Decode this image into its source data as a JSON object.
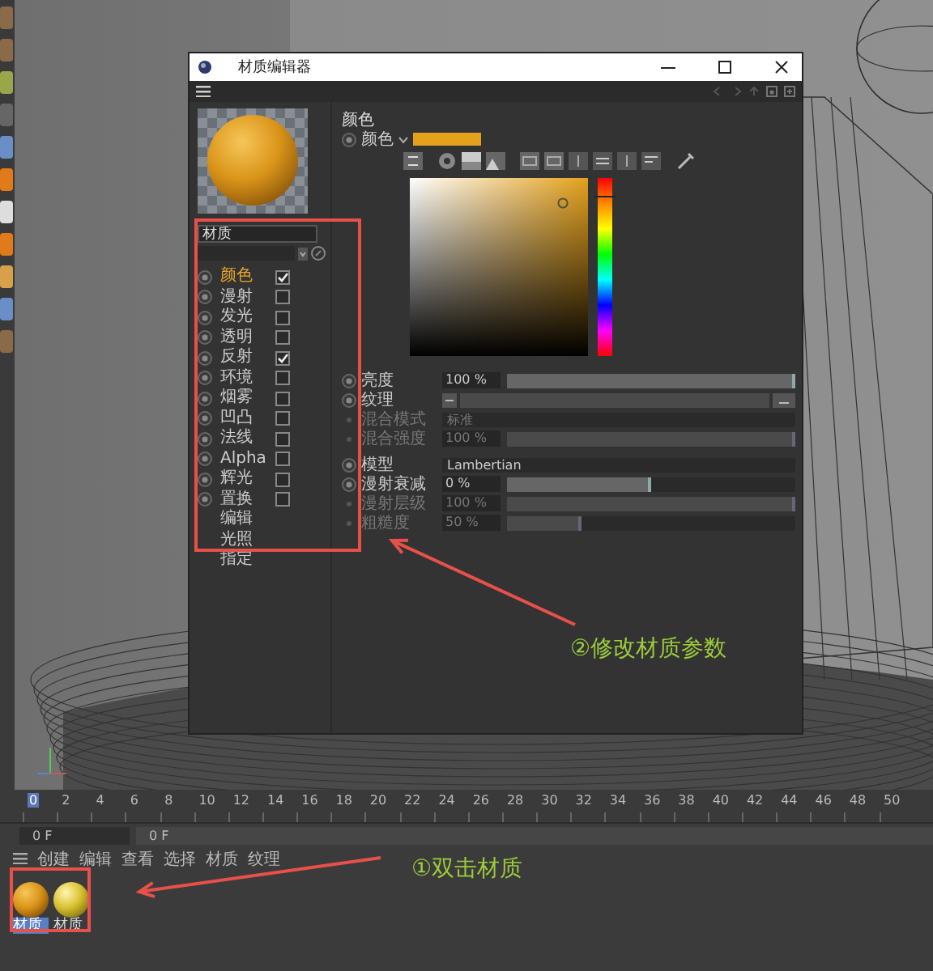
{
  "window": {
    "title": "材质编辑器"
  },
  "name_field": {
    "value": "材质"
  },
  "channels": [
    {
      "label": "颜色",
      "kind": "channel",
      "checked": true,
      "selected": true
    },
    {
      "label": "漫射",
      "kind": "channel",
      "checked": false,
      "selected": false
    },
    {
      "label": "发光",
      "kind": "channel",
      "checked": false,
      "selected": false
    },
    {
      "label": "透明",
      "kind": "channel",
      "checked": false,
      "selected": false
    },
    {
      "label": "反射",
      "kind": "channel",
      "checked": true,
      "selected": false
    },
    {
      "label": "环境",
      "kind": "channel",
      "checked": false,
      "selected": false
    },
    {
      "label": "烟雾",
      "kind": "channel",
      "checked": false,
      "selected": false
    },
    {
      "label": "凹凸",
      "kind": "channel",
      "checked": false,
      "selected": false
    },
    {
      "label": "法线",
      "kind": "channel",
      "checked": false,
      "selected": false
    },
    {
      "label": "Alpha",
      "kind": "channel",
      "checked": false,
      "selected": false
    },
    {
      "label": "辉光",
      "kind": "channel",
      "checked": false,
      "selected": false
    },
    {
      "label": "置换",
      "kind": "channel",
      "checked": false,
      "selected": false
    },
    {
      "label": "编辑",
      "kind": "page",
      "selected": false
    },
    {
      "label": "光照",
      "kind": "page",
      "selected": false
    },
    {
      "label": "指定",
      "kind": "page",
      "selected": false
    }
  ],
  "section_title": "颜色",
  "color_row": {
    "label": "颜色",
    "color": "#e4a11c"
  },
  "hue_slider": {
    "level": 0.9
  },
  "params": [
    {
      "label": "亮度",
      "kind": "slider",
      "value": "100 %",
      "level": 1,
      "disabled": false
    },
    {
      "label": "纹理",
      "kind": "texture",
      "disabled": false
    },
    {
      "label": "混合模式",
      "kind": "dropdown",
      "value": "标准",
      "disabled": true
    },
    {
      "label": "混合强度",
      "kind": "slider",
      "value": "100 %",
      "level": 1,
      "disabled": true
    },
    {
      "label": "模型",
      "kind": "dropdown",
      "value": "Lambertian",
      "disabled": false
    },
    {
      "label": "漫射衰减",
      "kind": "slider",
      "value": "0 %",
      "level": 0.5,
      "disabled": false
    },
    {
      "label": "漫射层级",
      "kind": "slider",
      "value": "100 %",
      "level": 1,
      "disabled": true
    },
    {
      "label": "粗糙度",
      "kind": "slider",
      "value": "50 %",
      "level": 0.26,
      "disabled": true
    }
  ],
  "timeline": {
    "ticks": [
      "0",
      "2",
      "4",
      "6",
      "8",
      "10",
      "12",
      "14",
      "16",
      "18",
      "20",
      "22",
      "24",
      "26",
      "28",
      "30",
      "32",
      "34",
      "36",
      "38",
      "40",
      "42",
      "44",
      "46",
      "48",
      "50"
    ],
    "current_frame": "0 F",
    "end_field": "0 F"
  },
  "material_manager": {
    "menu": [
      "创建",
      "编辑",
      "查看",
      "选择",
      "材质",
      "纹理"
    ],
    "materials": [
      {
        "name": "材质",
        "selected": true
      },
      {
        "name": "材质",
        "selected": false
      }
    ]
  },
  "annotations": [
    {
      "text": "②修改材质参数"
    },
    {
      "text": "①双击材质"
    }
  ]
}
